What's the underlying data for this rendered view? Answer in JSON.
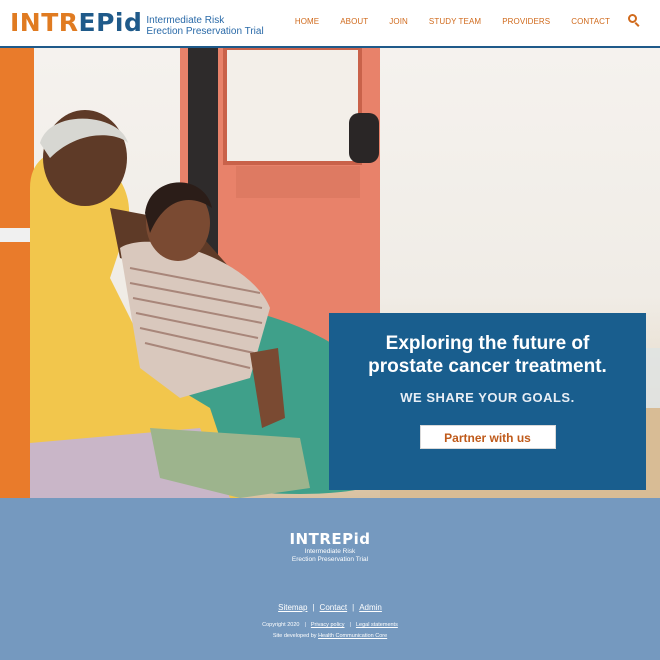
{
  "header": {
    "logo": {
      "word_part1": "INTR",
      "word_part2": "EPid",
      "tagline_line1": "Intermediate Risk",
      "tagline_line2": "Erection Preservation Trial"
    },
    "nav": [
      {
        "label": "HOME"
      },
      {
        "label": "ABOUT"
      },
      {
        "label": "JOIN"
      },
      {
        "label": "STUDY TEAM"
      },
      {
        "label": "PROVIDERS"
      },
      {
        "label": "CONTACT"
      }
    ],
    "search_icon": "search-icon"
  },
  "hero": {
    "image": "couple-sitting-in-orange-van-at-beach-photo",
    "callout": {
      "title_line1": "Exploring the future of",
      "title_line2": "prostate cancer treatment.",
      "subtitle": "WE SHARE YOUR GOALS.",
      "button_label": "Partner with us"
    }
  },
  "footer": {
    "logo": {
      "word": "INTREPid",
      "tagline_line1": "Intermediate Risk",
      "tagline_line2": "Erection Preservation Trial"
    },
    "links": [
      {
        "label": "Sitemap"
      },
      {
        "label": "Contact"
      },
      {
        "label": "Admin"
      }
    ],
    "copyright_prefix": "Copyright 2020",
    "copyright_links": [
      {
        "label": "Privacy policy"
      },
      {
        "label": "Legal statements"
      }
    ],
    "developed_prefix": "Site developed by",
    "developed_link": "Health Communication Core"
  },
  "colors": {
    "orange": "#e07b21",
    "blue": "#1f5a8a",
    "callout_blue": "#195e8e",
    "footer_blue": "#7599bf"
  }
}
